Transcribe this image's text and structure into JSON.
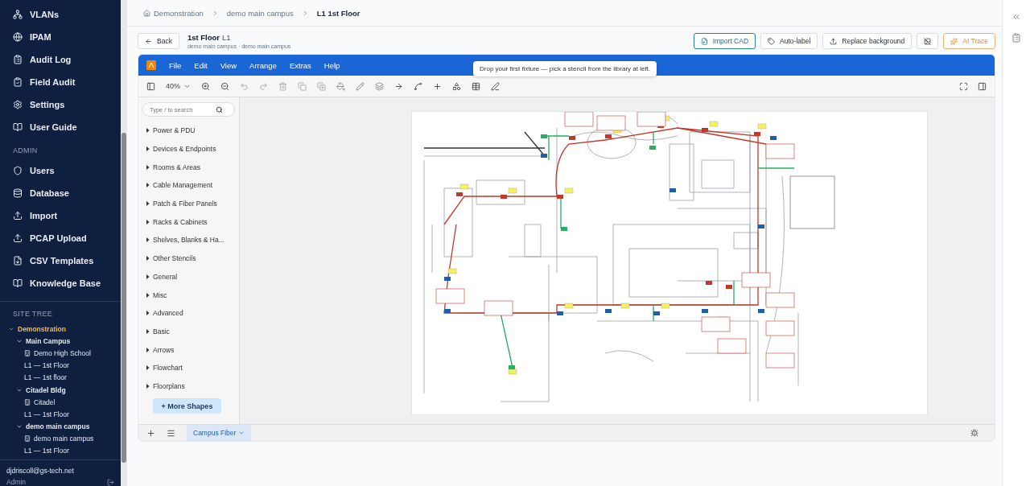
{
  "sidebar": {
    "nav": [
      {
        "label": "VLANs"
      },
      {
        "label": "IPAM"
      },
      {
        "label": "Audit Log"
      },
      {
        "label": "Field Audit"
      },
      {
        "label": "Settings"
      },
      {
        "label": "User Guide"
      }
    ],
    "admin_heading": "ADMIN",
    "admin": [
      {
        "label": "Users"
      },
      {
        "label": "Database"
      },
      {
        "label": "Import"
      },
      {
        "label": "PCAP Upload"
      },
      {
        "label": "CSV Templates"
      },
      {
        "label": "Knowledge Base"
      }
    ],
    "site_tree_heading": "SITE TREE",
    "site_tree": [
      {
        "label": "Demonstration",
        "kind": "group",
        "expanded": true,
        "selected": true,
        "children": [
          {
            "label": "Main Campus",
            "kind": "group",
            "expanded": true,
            "selected": false,
            "children": [
              {
                "label": "Demo High School",
                "kind": "building",
                "selected": false
              },
              {
                "label": "L1 — 1st Floor",
                "kind": "floor",
                "selected": false
              },
              {
                "label": "L1 — 1st floor",
                "kind": "floor",
                "selected": false
              }
            ]
          },
          {
            "label": "Citadel Bldg",
            "kind": "group",
            "expanded": true,
            "selected": false,
            "children": [
              {
                "label": "Citadel",
                "kind": "building",
                "selected": false
              },
              {
                "label": "L1 — 1st Floor",
                "kind": "floor",
                "selected": false
              }
            ]
          },
          {
            "label": "demo main campus",
            "kind": "group",
            "expanded": true,
            "selected": false,
            "children": [
              {
                "label": "demo main campus",
                "kind": "building",
                "selected": false
              },
              {
                "label": "L1 — 1st Floor",
                "kind": "floor",
                "selected": false
              }
            ]
          }
        ]
      }
    ],
    "user_email": "djdriscoll@gs-tech.net",
    "user_role": "Admin"
  },
  "breadcrumbs": [
    {
      "label": "Demonstration",
      "current": false
    },
    {
      "label": "demo main campus",
      "current": false
    },
    {
      "label": "L1 1st Floor",
      "current": true
    }
  ],
  "header": {
    "back": "Back",
    "title": "1st Floor",
    "level": "L1",
    "subtitle": "demo main campus · demo main campus",
    "actions": [
      {
        "label": "Import CAD",
        "kind": "primary"
      },
      {
        "label": "Auto-label",
        "kind": "plain"
      },
      {
        "label": "Replace background",
        "kind": "plain"
      },
      {
        "kind": "icon"
      },
      {
        "label": "AI Trace",
        "kind": "accent"
      }
    ]
  },
  "editor": {
    "menu": [
      "File",
      "Edit",
      "View",
      "Arrange",
      "Extras",
      "Help"
    ],
    "tooltip": "Drop your first fixture — pick a stencil from the library at left.",
    "zoom": "40%",
    "search": {
      "placeholder": "Type / to search"
    },
    "library": [
      {
        "label": "Power & PDU",
        "expanded": false
      },
      {
        "label": "Devices & Endpoints",
        "expanded": false
      },
      {
        "label": "Rooms & Areas",
        "expanded": false
      },
      {
        "label": "Cable Management",
        "expanded": false
      },
      {
        "label": "Patch & Fiber Panels",
        "expanded": false
      },
      {
        "label": "Racks & Cabinets",
        "expanded": false
      },
      {
        "label": "Shelves, Blanks & Ha...",
        "expanded": false
      },
      {
        "label": "Other Stencils",
        "expanded": false
      },
      {
        "label": "General",
        "expanded": false
      },
      {
        "label": "Misc",
        "expanded": false
      },
      {
        "label": "Advanced",
        "expanded": false
      },
      {
        "label": "Basic",
        "expanded": false
      },
      {
        "label": "Arrows",
        "expanded": false
      },
      {
        "label": "Flowchart",
        "expanded": false
      },
      {
        "label": "Floorplans",
        "expanded": false
      }
    ],
    "more_shapes": "+ More Shapes",
    "pages": [
      {
        "label": "Campus Fiber",
        "selected": true
      }
    ]
  }
}
